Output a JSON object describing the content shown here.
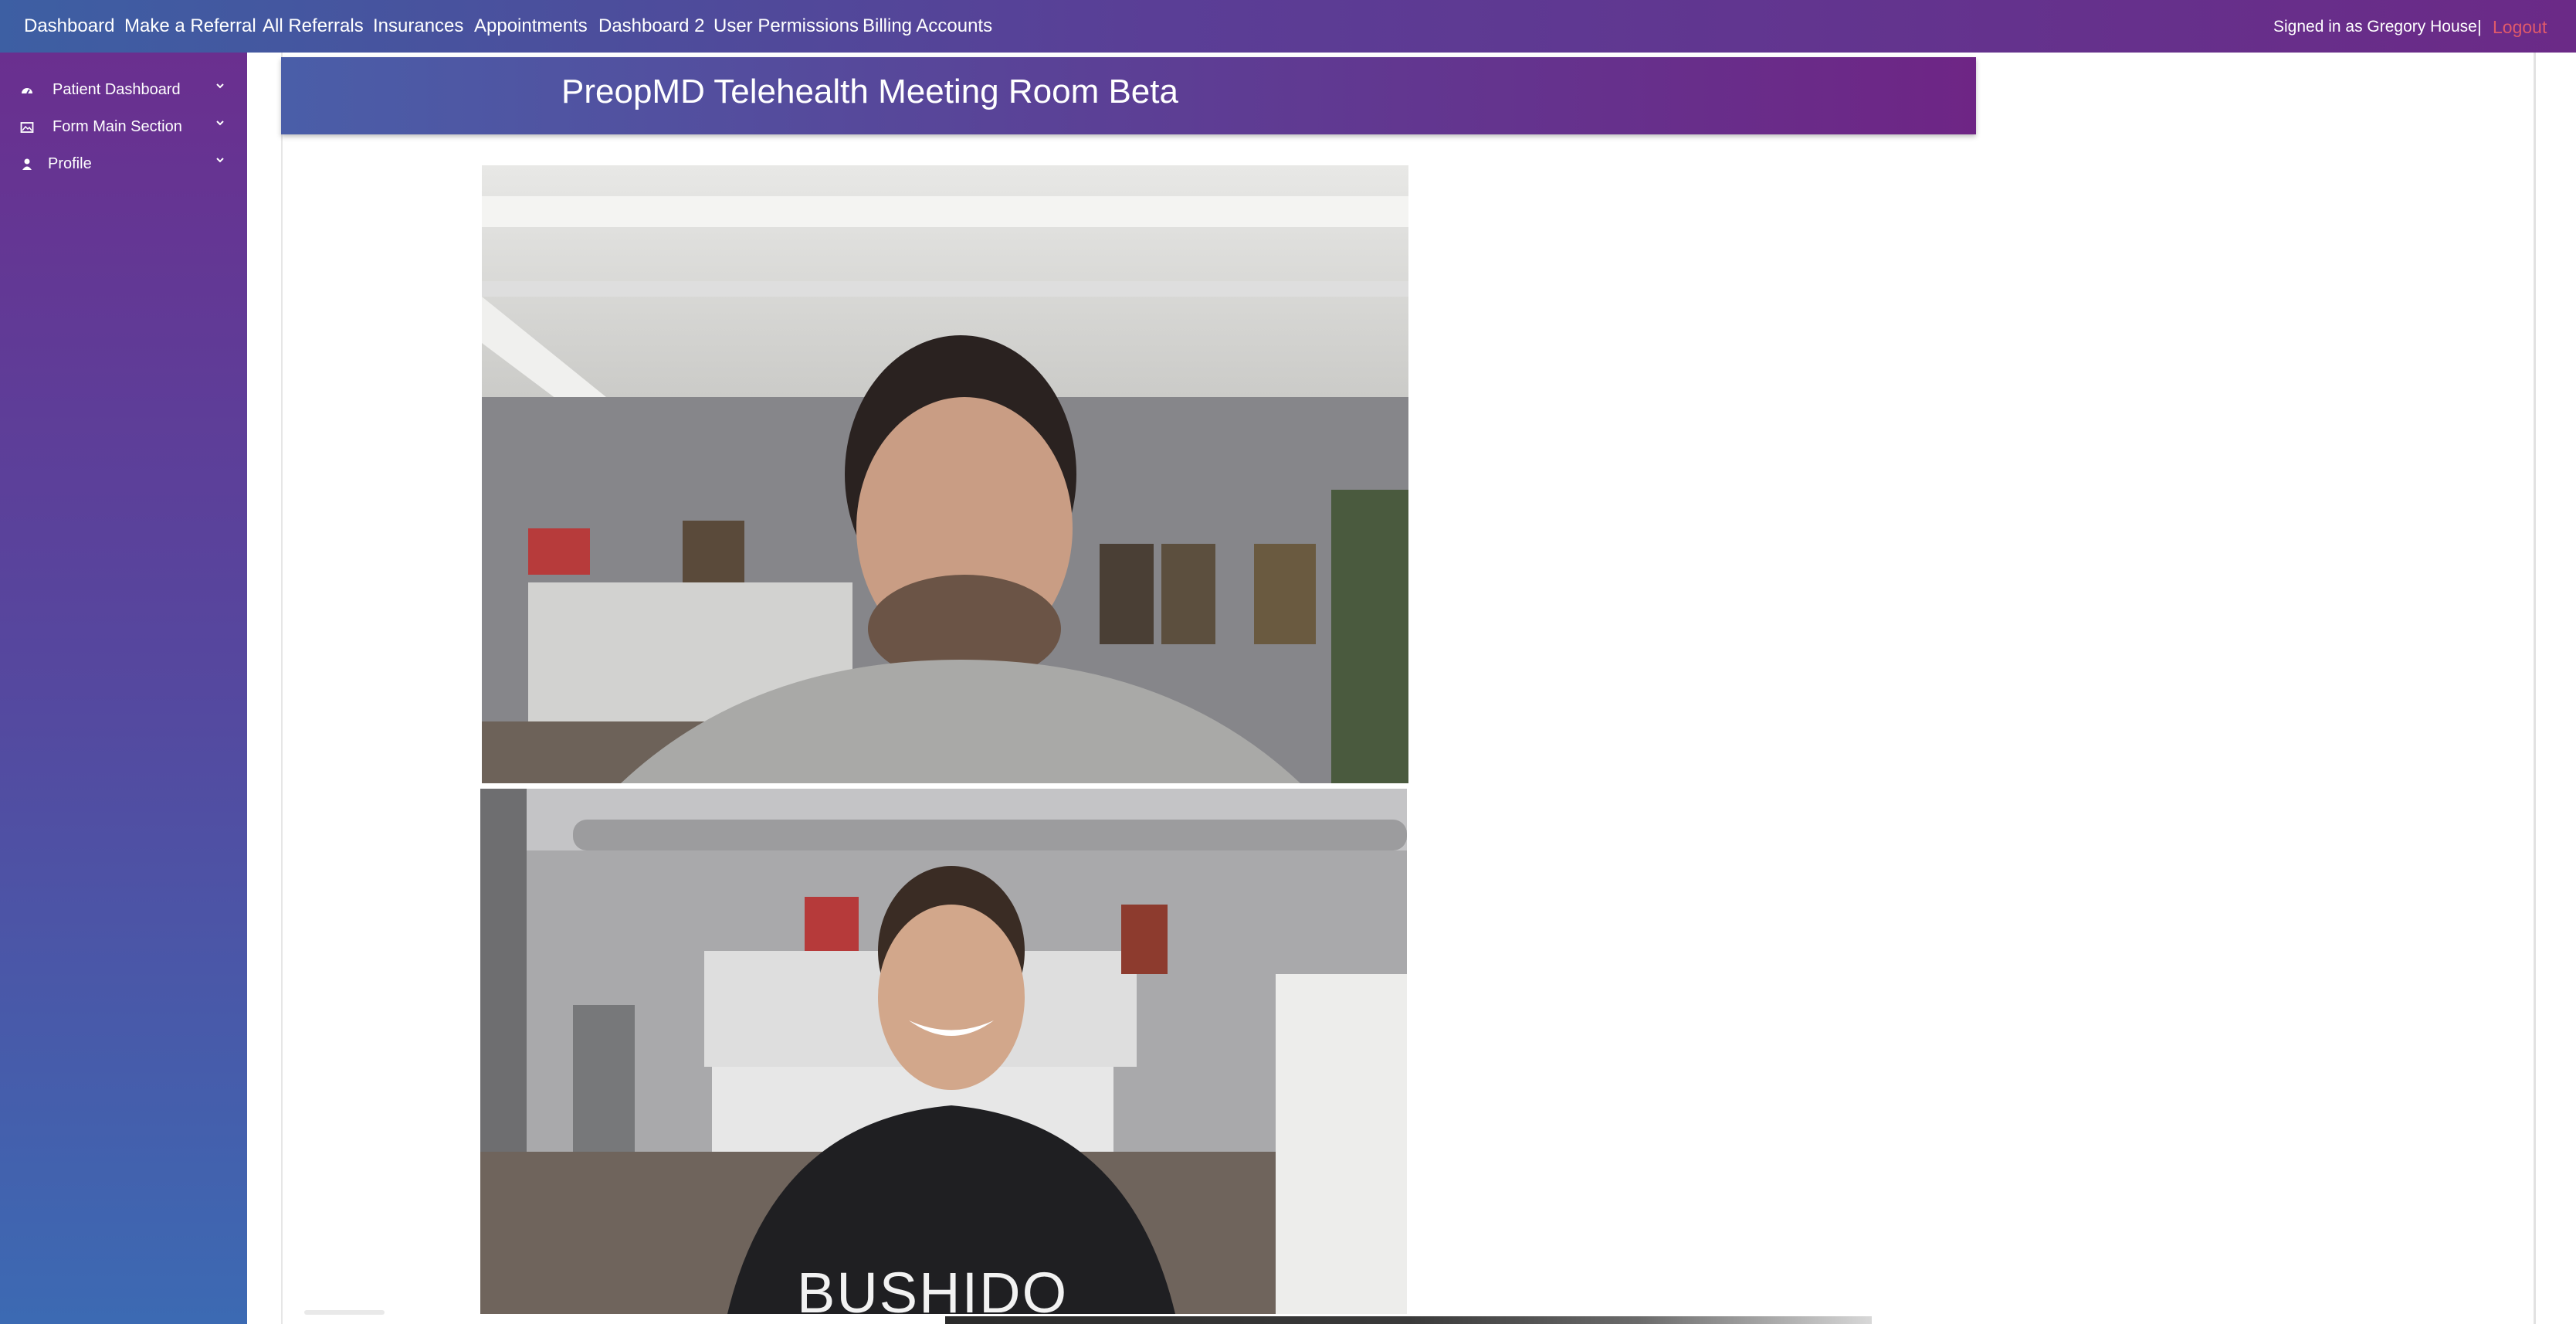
{
  "topbar": {
    "nav": [
      {
        "label": "Dashboard"
      },
      {
        "label": "Make a Referral"
      },
      {
        "label": "All Referrals"
      },
      {
        "label": "Insurances"
      },
      {
        "label": "Appointments"
      },
      {
        "label": "Dashboard 2"
      },
      {
        "label": "User Permissions"
      },
      {
        "label": "Billing Accounts"
      }
    ],
    "signed_in_text": "Signed in as Gregory House",
    "separator": "|",
    "logout_label": "Logout"
  },
  "sidebar": {
    "items": [
      {
        "label": "Patient Dashboard",
        "icon": "dashboard-icon"
      },
      {
        "label": "Form Main Section",
        "icon": "image-icon"
      },
      {
        "label": "Profile",
        "icon": "user-icon"
      }
    ]
  },
  "main": {
    "title": "PreopMD Telehealth Meeting Room Beta",
    "videos": [
      {
        "name": "remote-participant-video"
      },
      {
        "name": "local-participant-video",
        "shirt_text": "BUSHIDO"
      }
    ]
  },
  "colors": {
    "accent_blue": "#3d5fa3",
    "accent_purple": "#6b2a87",
    "logout": "#e05a6a"
  }
}
